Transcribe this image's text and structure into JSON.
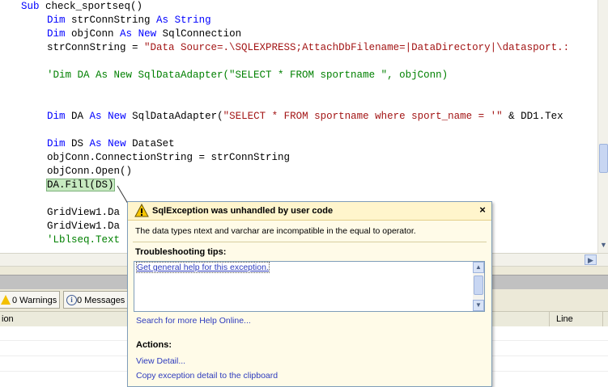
{
  "editor": {
    "lines": [
      {
        "kw1": "Sub",
        "text": " check_sportseq()"
      },
      {
        "kw1": "Dim",
        "text": " strConnString ",
        "kw2": "As",
        "text2": " ",
        "kw3": "String"
      },
      {
        "kw1": "Dim",
        "text": " objConn ",
        "kw2": "As",
        "text2": " ",
        "kw3": "New",
        "text3": " SqlConnection"
      },
      {
        "text": "strConnString = ",
        "str": "\"Data Source=.\\SQLEXPRESS;AttachDbFilename=|DataDirectory|\\datasport.:"
      },
      {
        "comment": "'Dim DA As New SqlDataAdapter(\"SELECT * FROM sportname \", objConn)"
      },
      {
        "kw1": "Dim",
        "text": " DA ",
        "kw2": "As",
        "text2": " ",
        "kw3": "New",
        "text3": " SqlDataAdapter(",
        "str": "\"SELECT * FROM sportname where sport_name = '\"",
        "text4": " & DD1.Tex"
      },
      {
        "kw1": "Dim",
        "text": " DS ",
        "kw2": "As",
        "text2": " ",
        "kw3": "New",
        "text3": " DataSet"
      },
      {
        "text": "objConn.ConnectionString = strConnString"
      },
      {
        "text": "objConn.Open()"
      },
      {
        "text": "DA.Fill(DS)"
      },
      {
        "text": "GridView1.Da"
      },
      {
        "text": "GridView1.Da"
      },
      {
        "comment": "'Lblseq.Text"
      }
    ]
  },
  "error_list": {
    "warnings_label": "0 Warnings",
    "messages_label": "0 Messages",
    "col_description": "ion",
    "col_line": "Line"
  },
  "exception": {
    "title": "SqlException was unhandled by user code",
    "message": "The data types ntext and varchar are incompatible in the equal to operator.",
    "tips_heading": "Troubleshooting tips:",
    "tip_link": "Get general help for this exception.",
    "help_online": "Search for more Help Online...",
    "actions_heading": "Actions:",
    "view_detail": "View Detail...",
    "copy_detail": "Copy exception detail to the clipboard",
    "close_glyph": "×"
  },
  "icons": {
    "warning": "warning-triangle-icon",
    "info": "info-circle-icon",
    "close": "close-icon"
  },
  "colors": {
    "keyword": "#0000ff",
    "string": "#a31515",
    "comment": "#008000",
    "link": "#2d3bbd",
    "popup_header": "#fff5cc",
    "highlight": "#c7e9c0"
  }
}
